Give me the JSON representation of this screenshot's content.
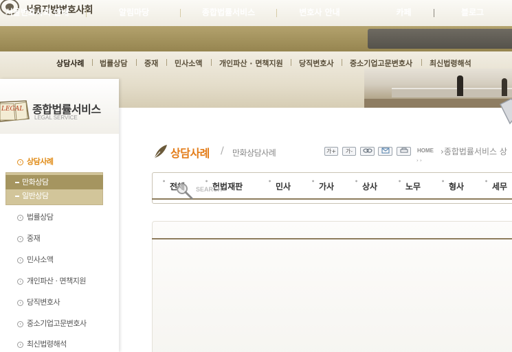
{
  "site": {
    "title": "서울지방변호사회"
  },
  "gnb": {
    "items": [
      "서울변호사회 안내",
      "알림마당",
      "종합법률서비스",
      "변호사 안내",
      "카페",
      "블로그"
    ]
  },
  "lnb": {
    "items": [
      "상담사례",
      "법률상담",
      "중재",
      "민사소액",
      "개인파산 · 면책지원",
      "당직변호사",
      "중소기업고문변호사",
      "최신법령해석"
    ]
  },
  "left": {
    "logo_badge": "LEGAL",
    "title": "종합법률서비스",
    "subtitle": "LEGAL SERVICE",
    "active_item": "상담사례",
    "sub_items": [
      "만화상담",
      "일반상담"
    ],
    "items": [
      "법률상담",
      "중재",
      "민사소액",
      "개인파산 · 면책지원",
      "당직변호사",
      "중소기업고문변호사",
      "최신법령해석"
    ]
  },
  "content": {
    "title": "상담사례",
    "slash": "/",
    "subtitle": "만화상담사례",
    "tools": [
      "가+",
      "가-",
      "link-icon",
      "mail-icon",
      "print-icon"
    ],
    "home": "HOME",
    "breadcrumb": "종합법률서비스 상",
    "breadcrumb_arrows": "› ›",
    "search_label": "SEARCH",
    "tabs": [
      "전체",
      "헌법재판",
      "민사",
      "가사",
      "상사",
      "노무",
      "형사",
      "세무"
    ]
  },
  "colors": {
    "accent": "#e37c18",
    "gold": "#a59560",
    "nav": "#a6955f"
  }
}
